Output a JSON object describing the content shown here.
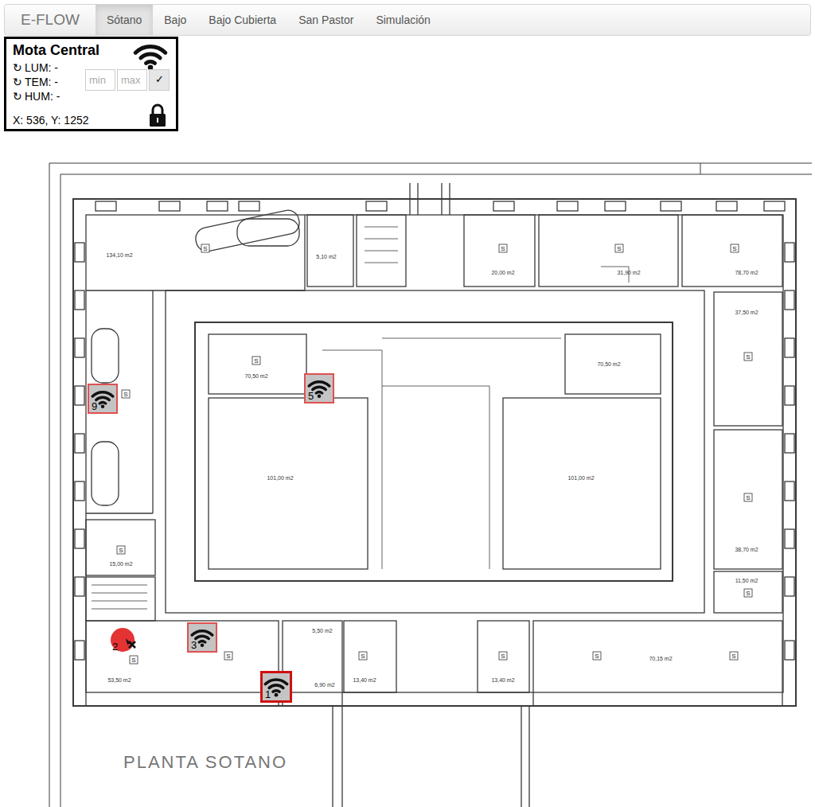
{
  "navbar": {
    "brand": "E-FLOW",
    "tabs": [
      {
        "label": "Sótano",
        "selected": true
      },
      {
        "label": "Bajo",
        "selected": false
      },
      {
        "label": "Bajo Cubierta",
        "selected": false
      },
      {
        "label": "San Pastor",
        "selected": false
      },
      {
        "label": "Simulación",
        "selected": false
      }
    ]
  },
  "mote": {
    "title": "Mota Central",
    "readings": [
      {
        "icon": "↻",
        "label": "LUM: -"
      },
      {
        "icon": "↻",
        "label": "TEM: -"
      },
      {
        "icon": "↻",
        "label": "HUM: -"
      }
    ],
    "min_placeholder": "min",
    "max_placeholder": "max",
    "confirm": "✓",
    "coords": "X: 536, Y: 1252",
    "locked": true
  },
  "plan": {
    "title": "PLANTA SOTANO",
    "labels": [
      "134,10 m2",
      "5,10 m2",
      "20,00 m2",
      "31,90 m2",
      "78,70 m2",
      "37,50 m2",
      "70,50 m2",
      "70,50 m2",
      "101,00 m2",
      "101,00 m2",
      "15,00 m2",
      "38,70 m2",
      "11,50 m2",
      "5,50 m2",
      "53,50 m2",
      "6,90 m2",
      "13,40 m2",
      "13,40 m2",
      "70,15 m2"
    ],
    "marks": [
      "S",
      "S",
      "S",
      "S",
      "S",
      "S",
      "S",
      "S",
      "S",
      "S",
      "S",
      "S",
      "S",
      "S",
      "S",
      "S"
    ]
  },
  "sensors": [
    {
      "label": "9",
      "selected": false,
      "alarm": false
    },
    {
      "label": "5",
      "selected": false,
      "alarm": false
    },
    {
      "label": "3",
      "selected": false,
      "alarm": false
    },
    {
      "label": "2",
      "selected": false,
      "alarm": true
    },
    {
      "label": "1",
      "selected": true,
      "alarm": false
    }
  ]
}
